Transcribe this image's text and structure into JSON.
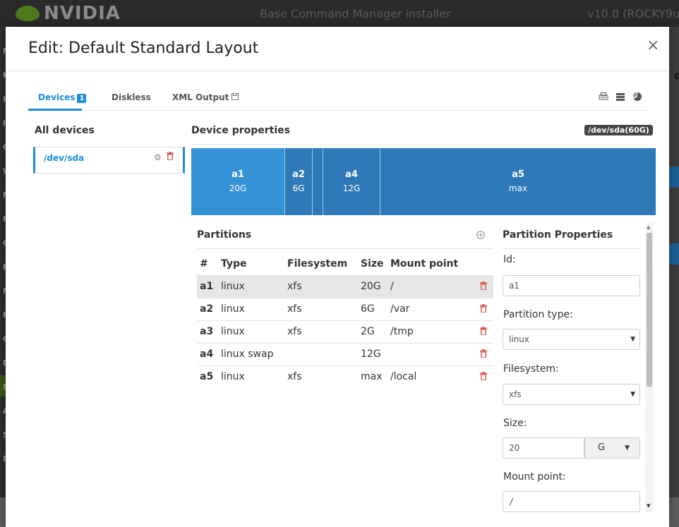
{
  "background": {
    "brand": "NVIDIA",
    "app_title": "Base Command Manager installer",
    "version": "v10.0 (ROCKY9u",
    "side_letters": [
      "N",
      "K",
      "H",
      "I",
      "C",
      "W",
      "N",
      "H",
      "C",
      "B",
      "N",
      "H",
      "C",
      "D",
      "D",
      "A",
      "S",
      "D"
    ],
    "right_letter": "d"
  },
  "modal": {
    "title": "Edit: Default Standard Layout",
    "close": "×"
  },
  "tabs": [
    {
      "label": "Devices",
      "badge": "1",
      "active": true
    },
    {
      "label": "Diskless",
      "active": false
    },
    {
      "label": "XML Output",
      "icon": "save-icon",
      "active": false
    }
  ],
  "toolbar_icons": [
    "print-icon",
    "disk-stack-icon",
    "pie-chart-icon"
  ],
  "left": {
    "title": "All devices",
    "devices": [
      {
        "name": "/dev/sda"
      }
    ]
  },
  "device_properties": {
    "title": "Device properties",
    "device_label": "/dev/sda(60G)",
    "segments": [
      {
        "name": "a1",
        "size": "20G"
      },
      {
        "name": "a2",
        "size": "6G"
      },
      {
        "name": "",
        "size": ""
      },
      {
        "name": "a4",
        "size": "12G"
      },
      {
        "name": "a5",
        "size": "max"
      }
    ]
  },
  "partitions": {
    "title": "Partitions",
    "columns": [
      "#",
      "Type",
      "Filesystem",
      "Size",
      "Mount point"
    ],
    "rows": [
      {
        "id": "a1",
        "type": "linux",
        "fs": "xfs",
        "size": "20G",
        "mount": "/",
        "selected": true
      },
      {
        "id": "a2",
        "type": "linux",
        "fs": "xfs",
        "size": "6G",
        "mount": "/var",
        "selected": false
      },
      {
        "id": "a3",
        "type": "linux",
        "fs": "xfs",
        "size": "2G",
        "mount": "/tmp",
        "selected": false
      },
      {
        "id": "a4",
        "type": "linux swap",
        "fs": "",
        "size": "12G",
        "mount": "",
        "selected": false
      },
      {
        "id": "a5",
        "type": "linux",
        "fs": "xfs",
        "size": "max",
        "mount": "/local",
        "selected": false
      }
    ]
  },
  "partition_properties": {
    "title": "Partition Properties",
    "id_label": "Id:",
    "id_value": "a1",
    "type_label": "Partition type:",
    "type_value": "linux",
    "fs_label": "Filesystem:",
    "fs_value": "xfs",
    "size_label": "Size:",
    "size_value": "20",
    "size_unit": "G",
    "mount_label": "Mount point:",
    "mount_value": "/"
  },
  "colors": {
    "accent": "#1a8fd6",
    "bar": "#2e7ab8",
    "bar_selected": "#3592d7",
    "delete": "#d9534f"
  }
}
